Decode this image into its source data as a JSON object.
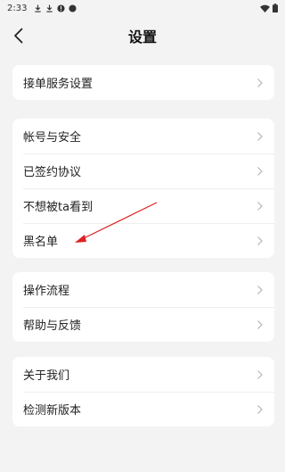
{
  "status_bar": {
    "time": "2:33",
    "icons": [
      "download-icon",
      "download-icon",
      "alert-icon",
      "notification-icon"
    ],
    "right_icons": [
      "wifi-icon",
      "battery-icon"
    ]
  },
  "header": {
    "title": "设置"
  },
  "groups": [
    {
      "items": [
        {
          "label": "接单服务设置"
        }
      ]
    },
    {
      "items": [
        {
          "label": "帐号与安全"
        },
        {
          "label": "已签约协议"
        },
        {
          "label": "不想被ta看到"
        },
        {
          "label": "黑名单"
        }
      ]
    },
    {
      "items": [
        {
          "label": "操作流程"
        },
        {
          "label": "帮助与反馈"
        }
      ]
    },
    {
      "items": [
        {
          "label": "关于我们"
        },
        {
          "label": "检测新版本"
        }
      ]
    }
  ],
  "colors": {
    "background": "#f3f3f3",
    "card": "#ffffff",
    "arrow_annotation": "#e02020"
  }
}
